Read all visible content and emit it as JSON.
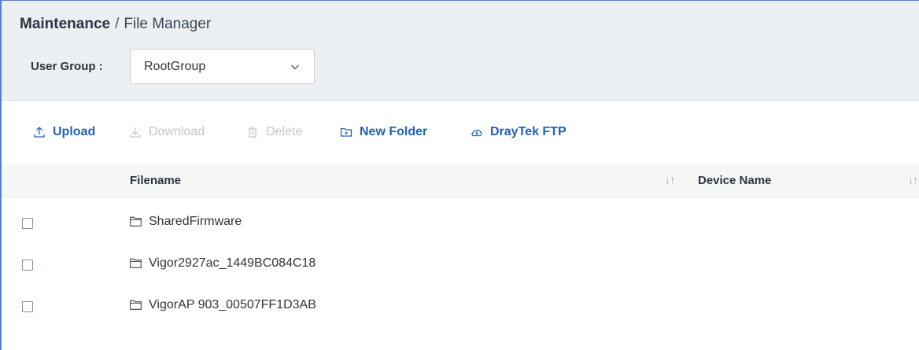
{
  "breadcrumb": {
    "root": "Maintenance",
    "separator": "/",
    "current": "File Manager"
  },
  "user_group": {
    "label": "User Group :",
    "selected": "RootGroup"
  },
  "toolbar": {
    "upload": "Upload",
    "download": "Download",
    "delete": "Delete",
    "new_folder": "New Folder",
    "draytek_ftp": "DrayTek FTP"
  },
  "table": {
    "columns": {
      "filename": "Filename",
      "device_name": "Device Name"
    },
    "sort_glyph": "↓↑",
    "rows": [
      {
        "name": "SharedFirmware"
      },
      {
        "name": "Vigor2927ac_1449BC084C18"
      },
      {
        "name": "VigorAP 903_00507FF1D3AB"
      }
    ]
  },
  "colors": {
    "accent": "#1f63b6",
    "disabled": "#c3c8ce",
    "header_bg": "#edf0f3",
    "frame_border": "#5b7fc4"
  },
  "icons": {
    "upload": "upload-icon",
    "download": "download-icon",
    "delete": "trash-icon",
    "new_folder": "new-folder-icon",
    "draytek_ftp": "cloud-icon",
    "row": "folder-icon",
    "select": "chevron-down-icon"
  }
}
